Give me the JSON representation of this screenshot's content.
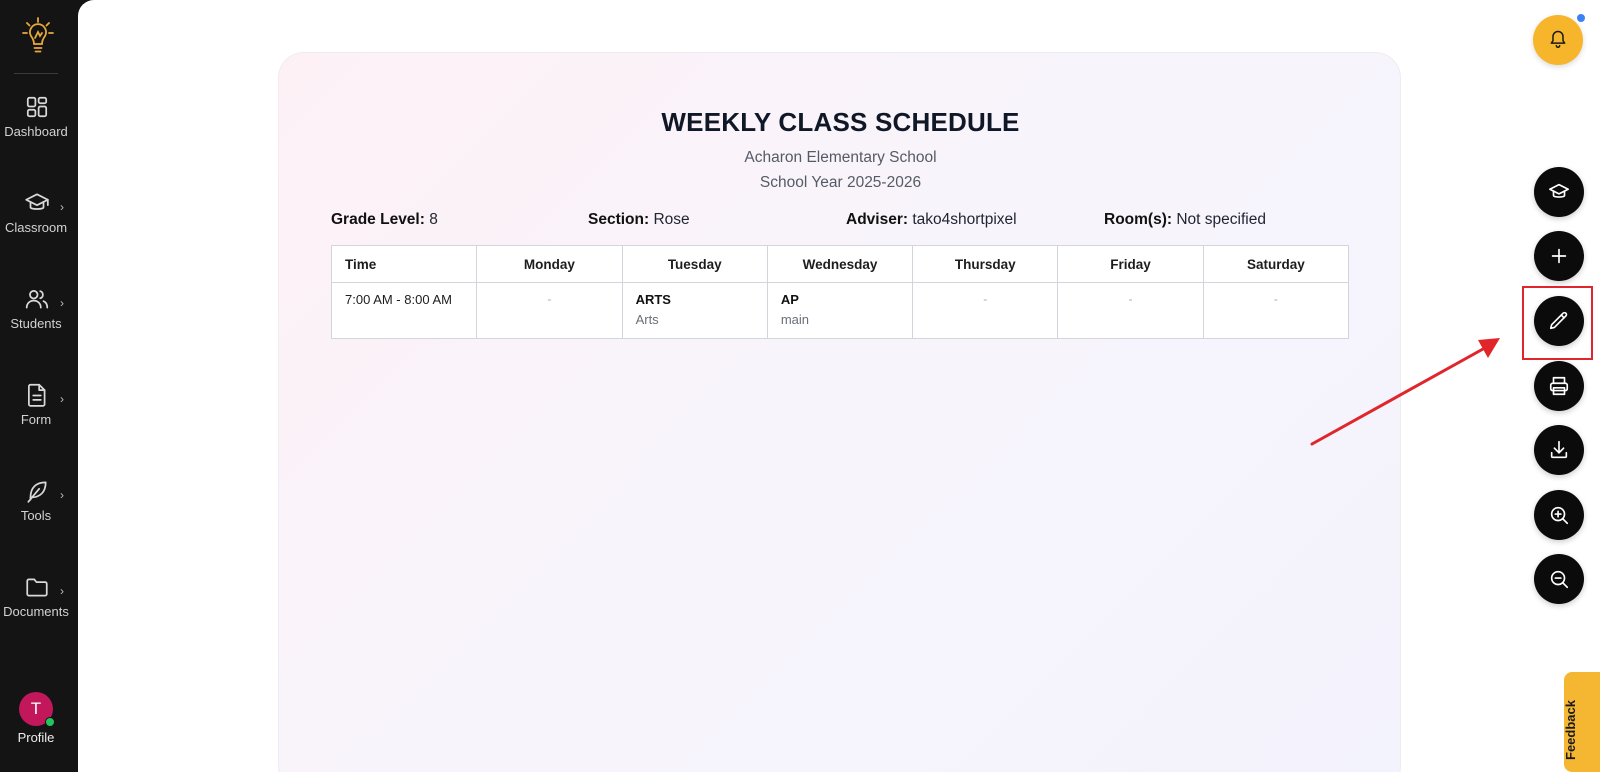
{
  "sidebar": {
    "items": [
      {
        "label": "Dashboard",
        "icon": "dashboard-icon"
      },
      {
        "label": "Classroom",
        "icon": "graduation-cap-icon"
      },
      {
        "label": "Students",
        "icon": "users-icon"
      },
      {
        "label": "Form",
        "icon": "document-icon"
      },
      {
        "label": "Tools",
        "icon": "feather-icon"
      },
      {
        "label": "Documents",
        "icon": "folder-icon"
      }
    ],
    "profile": {
      "initial": "T",
      "label": "Profile"
    }
  },
  "schedule": {
    "title": "WEEKLY CLASS SCHEDULE",
    "school": "Acharon Elementary School",
    "school_year": "School Year 2025-2026",
    "info": {
      "grade_label": "Grade Level:",
      "grade_value": "8",
      "section_label": "Section:",
      "section_value": "Rose",
      "adviser_label": "Adviser:",
      "adviser_value": "tako4shortpixel",
      "rooms_label": "Room(s):",
      "rooms_value": "Not specified"
    },
    "columns": [
      "Time",
      "Monday",
      "Tuesday",
      "Wednesday",
      "Thursday",
      "Friday",
      "Saturday"
    ],
    "rows": [
      {
        "time": "7:00 AM - 8:00 AM",
        "monday": "-",
        "tuesday": {
          "subject": "ARTS",
          "room": "Arts"
        },
        "wednesday": {
          "subject": "AP",
          "room": "main"
        },
        "thursday": "-",
        "friday": "-",
        "saturday": "-"
      }
    ]
  },
  "fabs": [
    {
      "icon": "graduation-cap-icon"
    },
    {
      "icon": "plus-icon"
    },
    {
      "icon": "pencil-icon"
    },
    {
      "icon": "printer-icon"
    },
    {
      "icon": "download-icon"
    },
    {
      "icon": "zoom-in-icon"
    },
    {
      "icon": "zoom-out-icon"
    }
  ],
  "feedback": {
    "label": "Feedback"
  },
  "colors": {
    "accent_yellow": "#f6b52a",
    "highlight_red": "#e0262a",
    "sidebar_bg": "#141414",
    "avatar": "#c2185b"
  }
}
